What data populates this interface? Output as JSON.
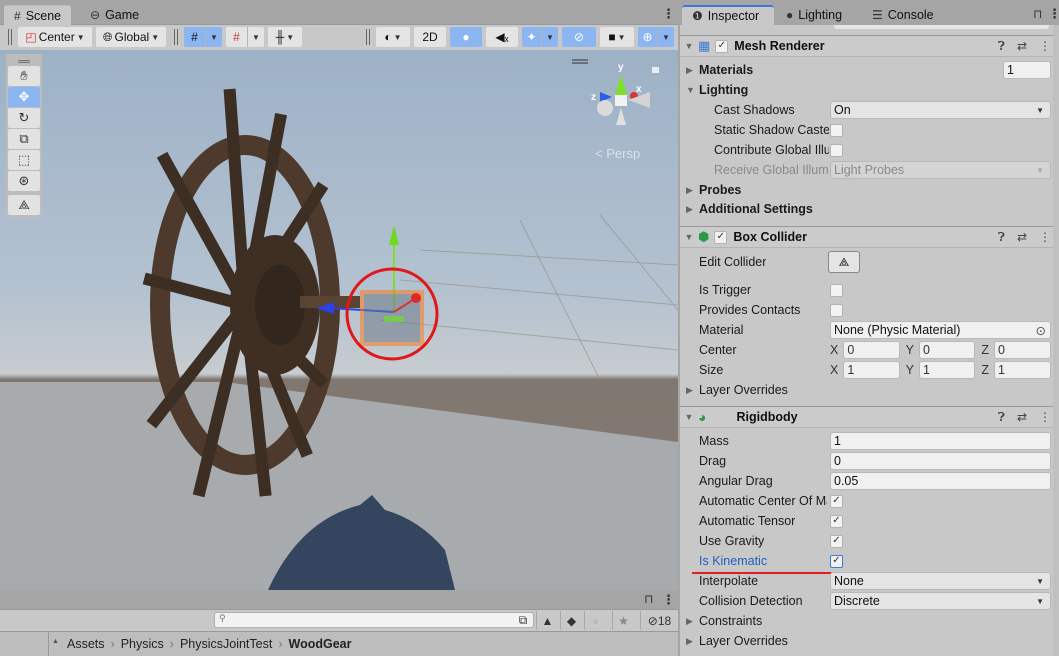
{
  "scene_window": {
    "tabs": [
      {
        "label": "Scene",
        "icon": "grid-icon",
        "active": true
      },
      {
        "label": "Game",
        "icon": "gamepad-icon",
        "active": false
      }
    ],
    "toolbar": {
      "pivot_mode": "Center",
      "pivot_rotation": "Global",
      "mode_2d": "2D"
    },
    "tools": [
      "hand",
      "move",
      "rotate",
      "scale",
      "rect",
      "transform",
      "edit-collider"
    ],
    "active_tool": "move",
    "orientation_gizmo": {
      "axes": [
        "y",
        "z",
        "x"
      ],
      "projection": "Persp"
    }
  },
  "project_window": {
    "search_placeholder": "",
    "hidden_count": "18",
    "breadcrumb": [
      "Assets",
      "Physics",
      "PhysicsJointTest",
      "WoodGear"
    ]
  },
  "inspector": {
    "tabs": [
      {
        "label": "Inspector",
        "icon": "info-icon",
        "active": true
      },
      {
        "label": "Lighting",
        "icon": "bulb-icon",
        "active": false
      },
      {
        "label": "Console",
        "icon": "console-icon",
        "active": false
      }
    ],
    "mesh_renderer": {
      "title": "Mesh Renderer",
      "enabled": true,
      "materials_label": "Materials",
      "materials_count": "1",
      "lighting_label": "Lighting",
      "cast_shadows_label": "Cast Shadows",
      "cast_shadows_value": "On",
      "static_shadow_label": "Static Shadow Caster",
      "contribute_gi_label": "Contribute Global Illumination",
      "receive_gi_label": "Receive Global Illumination",
      "receive_gi_value": "Light Probes",
      "probes_label": "Probes",
      "additional_label": "Additional Settings"
    },
    "box_collider": {
      "title": "Box Collider",
      "enabled": true,
      "edit_collider_label": "Edit Collider",
      "is_trigger_label": "Is Trigger",
      "provides_contacts_label": "Provides Contacts",
      "material_label": "Material",
      "material_value": "None (Physic Material)",
      "center_label": "Center",
      "center": {
        "x": "0",
        "y": "0",
        "z": "0"
      },
      "size_label": "Size",
      "size": {
        "x": "1",
        "y": "1",
        "z": "1"
      },
      "layer_overrides_label": "Layer Overrides"
    },
    "rigidbody": {
      "title": "Rigidbody",
      "mass_label": "Mass",
      "mass": "1",
      "drag_label": "Drag",
      "drag": "0",
      "angular_drag_label": "Angular Drag",
      "angular_drag": "0.05",
      "auto_com_label": "Automatic Center Of Mass",
      "auto_com": true,
      "auto_tensor_label": "Automatic Tensor",
      "auto_tensor": true,
      "use_gravity_label": "Use Gravity",
      "use_gravity": true,
      "is_kinematic_label": "Is Kinematic",
      "is_kinematic": true,
      "interpolate_label": "Interpolate",
      "interpolate": "None",
      "collision_label": "Collision Detection",
      "collision": "Discrete",
      "constraints_label": "Constraints",
      "layer_overrides_label": "Layer Overrides"
    },
    "axis_labels": {
      "x": "X",
      "y": "Y",
      "z": "Z"
    },
    "check_glyph": "✓",
    "colors": {
      "accent": "#3a79d8",
      "highlight_label": "#1f5fbf",
      "annotation_red": "#e02020"
    }
  }
}
